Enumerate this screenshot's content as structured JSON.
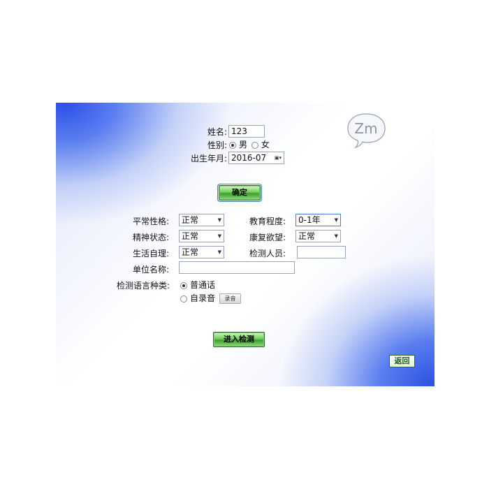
{
  "top_form": {
    "name_label": "姓名:",
    "name_value": "123",
    "gender_label": "性别:",
    "gender_options": [
      "男",
      "女"
    ],
    "gender_selected": "男",
    "birth_label": "出生年月:",
    "birth_value": "2016-07"
  },
  "confirm_button": "确定",
  "details": {
    "personality_label": "平常性格:",
    "personality_value": "正常",
    "education_label": "教育程度:",
    "education_value": "0-1年",
    "mental_label": "精神状态:",
    "mental_value": "正常",
    "recovery_label": "康复欲望:",
    "recovery_value": "正常",
    "selfcare_label": "生活自理:",
    "selfcare_value": "正常",
    "examiner_label": "检测人员:",
    "examiner_value": "",
    "unit_label": "单位名称:",
    "unit_value": ""
  },
  "language": {
    "label": "检测语言种类:",
    "options": [
      "普通话",
      "自录音"
    ],
    "selected": "普通话",
    "record_button": "录音"
  },
  "enter_button": "进入检测",
  "back_button": "返回",
  "logo_text": "Zm",
  "colors": {
    "accent_blue": "#2a4fe8",
    "button_green": "#6fcf5a"
  }
}
